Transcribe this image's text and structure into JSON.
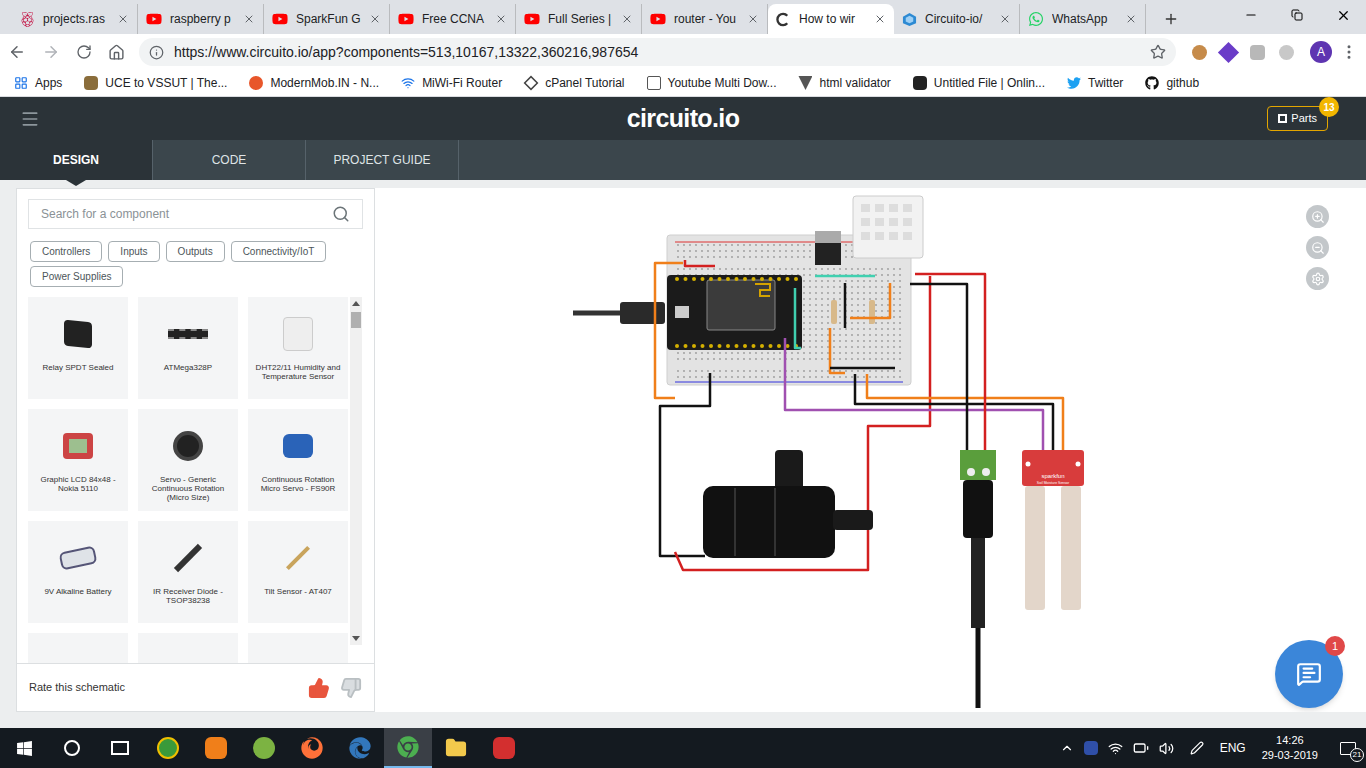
{
  "browser": {
    "tabs": [
      {
        "label": "projects.ras",
        "selected": false
      },
      {
        "label": "raspberry p",
        "selected": false
      },
      {
        "label": "SparkFun G",
        "selected": false
      },
      {
        "label": "Free CCNA",
        "selected": false
      },
      {
        "label": "Full Series |",
        "selected": false
      },
      {
        "label": "router - You",
        "selected": false
      },
      {
        "label": "How to wir",
        "selected": true
      },
      {
        "label": "Circuito-io/",
        "selected": false
      },
      {
        "label": "WhatsApp",
        "selected": false
      }
    ],
    "url": "https://www.circuito.io/app?components=513,10167,13322,360216,987654",
    "profile": "A",
    "bookmarks": [
      "Apps",
      "UCE to VSSUT | The...",
      "ModernMob.IN - N...",
      "MiWi-Fi Router",
      "cPanel Tutorial",
      "Youtube Multi Dow...",
      "html validator",
      "Untitled File | Onlin...",
      "Twitter",
      "github"
    ]
  },
  "app": {
    "logo": "circuito.io",
    "parts": {
      "label": "Parts",
      "count": "13"
    },
    "nav": [
      {
        "label": "DESIGN",
        "selected": true
      },
      {
        "label": "CODE",
        "selected": false
      },
      {
        "label": "PROJECT GUIDE",
        "selected": false
      }
    ]
  },
  "sidebar": {
    "search": {
      "placeholder": "Search for a component"
    },
    "categories": [
      "Controllers",
      "Inputs",
      "Outputs",
      "Connectivity/IoT",
      "Power Supplies"
    ],
    "components": [
      "Relay SPDT Sealed",
      "ATMega328P",
      "DHT22/11 Humidity and Temperature Sensor",
      "Graphic LCD 84x48 - Nokia 5110",
      "Servo - Generic Continuous Rotation (Micro Size)",
      "Continuous Rotation Micro Servo - FS90R",
      "9V Alkaline Battery",
      "IR Receiver Diode - TSOP38238",
      "Tilt Sensor - AT407"
    ],
    "rating": "Rate this schematic"
  },
  "canvas": {
    "sensor_brand": "sparkfun",
    "sensor_name": "Soil Moisture Sensor"
  },
  "chat": {
    "badge": "1"
  },
  "taskbar": {
    "language": "ENG",
    "time": "14:26",
    "date": "29-03-2019",
    "notifications": "21"
  }
}
